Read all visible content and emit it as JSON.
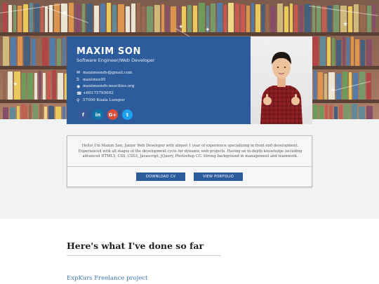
{
  "profile": {
    "name": "MAXIM SON",
    "role": "Software Engineer/Web Developer",
    "contacts": [
      {
        "icon": "envelope-icon",
        "text": "maximsondv@gmail.com"
      },
      {
        "icon": "skype-icon",
        "text": "maximus95"
      },
      {
        "icon": "globe-icon",
        "text": "maximsondv.neocities.org"
      },
      {
        "icon": "phone-icon",
        "text": "+60175795692"
      },
      {
        "icon": "location-pin-icon",
        "text": "57000 Kuala Lumpur"
      }
    ],
    "socials": [
      {
        "name": "facebook",
        "glyph": "f",
        "color": "#3b5998"
      },
      {
        "name": "linkedin",
        "glyph": "in",
        "color": "#0e76a8"
      },
      {
        "name": "google-plus",
        "glyph": "G+",
        "color": "#dd4b39"
      },
      {
        "name": "twitter",
        "glyph": "t",
        "color": "#1da1f2"
      }
    ]
  },
  "bio": {
    "text": "Hello! I'm Maxim Son, Junior Web Developer with almost 1 year of experience specializing in front end development. Experienced with all stages of the development cycle for dynamic web projects. Having an in-depth knowledge including advanced HTML5, CSS, CSS3, Javascript, JQuery, Photoshop CC. Strong background in management and teamwork.",
    "download_label": "DOWNLOAD CV",
    "portfolio_label": "VIEW PORFOLIO"
  },
  "section": {
    "title": "Here's what I've done so far",
    "project_link": "ExpKurs Freelance project"
  },
  "colors": {
    "accent": "#2d5c9c",
    "link": "#3d74b8"
  }
}
